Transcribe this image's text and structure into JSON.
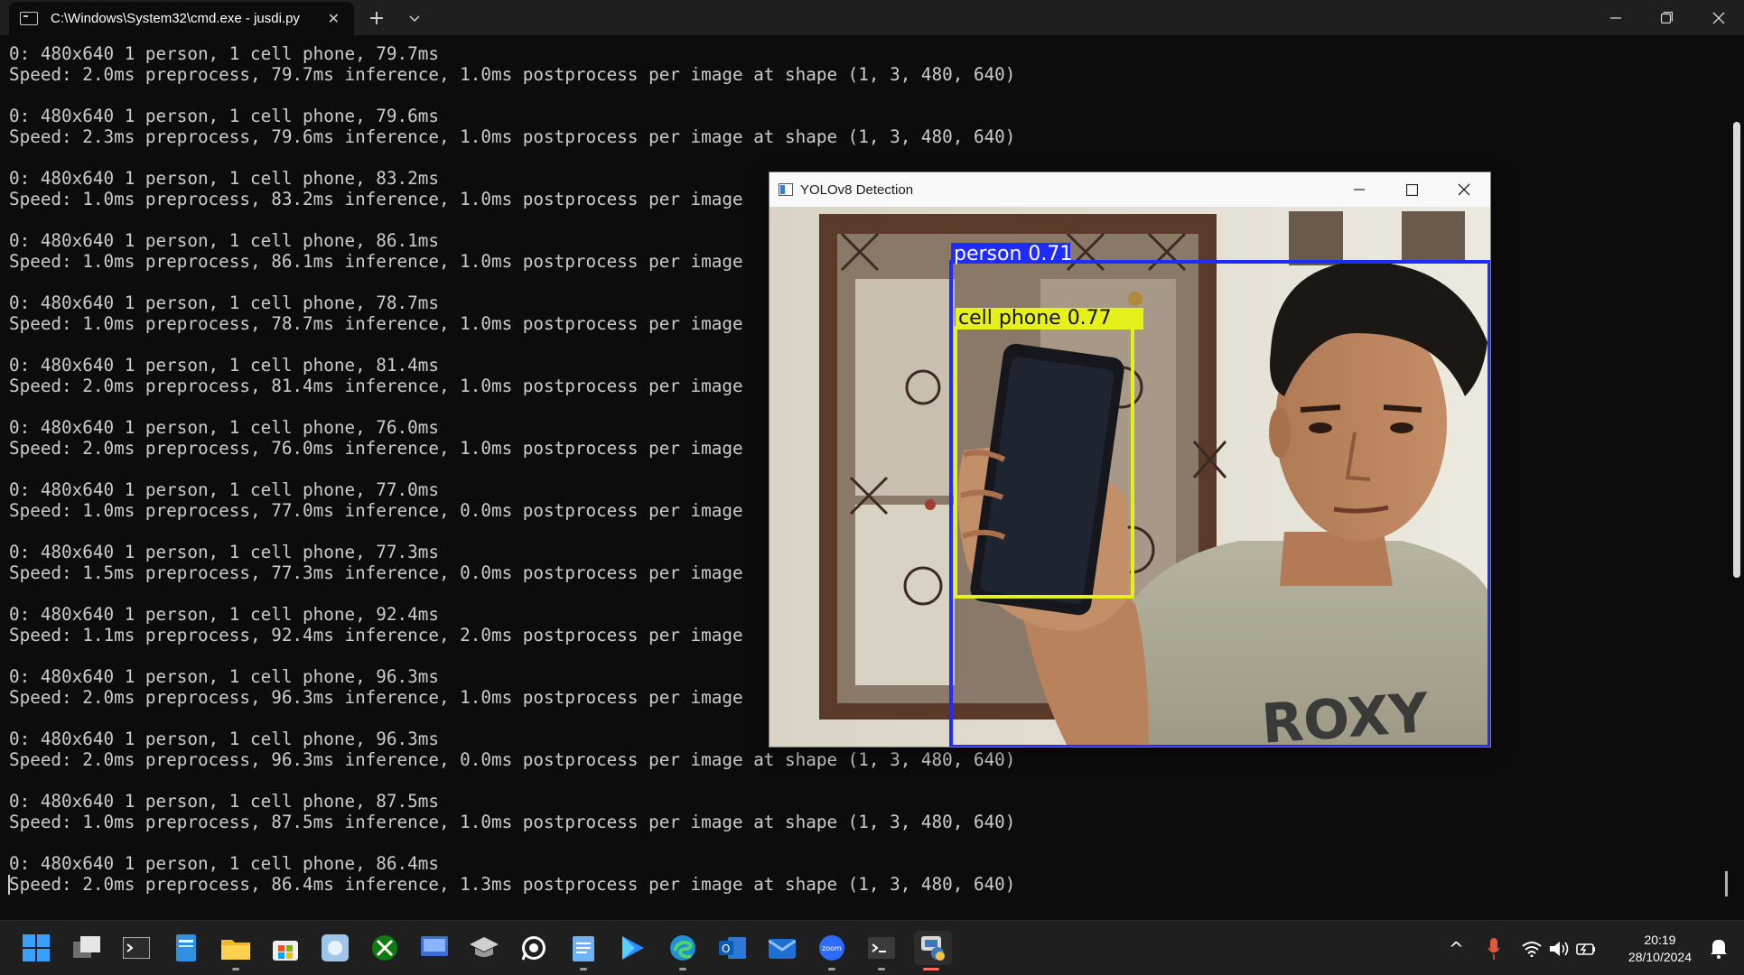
{
  "window": {
    "tab_title": "C:\\Windows\\System32\\cmd.exe - jusdi.py",
    "tab_close": "✕",
    "new_tab": "+",
    "dropdown": "⌄",
    "minimize": "─",
    "restore": "❐",
    "close": "✕"
  },
  "terminal": {
    "lines": [
      "0: 480x640 1 person, 1 cell phone, 79.7ms",
      "Speed: 2.0ms preprocess, 79.7ms inference, 1.0ms postprocess per image at shape (1, 3, 480, 640)",
      "",
      "0: 480x640 1 person, 1 cell phone, 79.6ms",
      "Speed: 2.3ms preprocess, 79.6ms inference, 1.0ms postprocess per image at shape (1, 3, 480, 640)",
      "",
      "0: 480x640 1 person, 1 cell phone, 83.2ms",
      "Speed: 1.0ms preprocess, 83.2ms inference, 1.0ms postprocess per image",
      "",
      "0: 480x640 1 person, 1 cell phone, 86.1ms",
      "Speed: 1.0ms preprocess, 86.1ms inference, 1.0ms postprocess per image",
      "",
      "0: 480x640 1 person, 1 cell phone, 78.7ms",
      "Speed: 1.0ms preprocess, 78.7ms inference, 1.0ms postprocess per image",
      "",
      "0: 480x640 1 person, 1 cell phone, 81.4ms",
      "Speed: 2.0ms preprocess, 81.4ms inference, 1.0ms postprocess per image",
      "",
      "0: 480x640 1 person, 1 cell phone, 76.0ms",
      "Speed: 2.0ms preprocess, 76.0ms inference, 1.0ms postprocess per image",
      "",
      "0: 480x640 1 person, 1 cell phone, 77.0ms",
      "Speed: 1.0ms preprocess, 77.0ms inference, 0.0ms postprocess per image",
      "",
      "0: 480x640 1 person, 1 cell phone, 77.3ms",
      "Speed: 1.5ms preprocess, 77.3ms inference, 0.0ms postprocess per image",
      "",
      "0: 480x640 1 person, 1 cell phone, 92.4ms",
      "Speed: 1.1ms preprocess, 92.4ms inference, 2.0ms postprocess per image",
      "",
      "0: 480x640 1 person, 1 cell phone, 96.3ms",
      "Speed: 2.0ms preprocess, 96.3ms inference, 1.0ms postprocess per image",
      "",
      "0: 480x640 1 person, 1 cell phone, 96.3ms",
      "Speed: 2.0ms preprocess, 96.3ms inference, 0.0ms postprocess per image at shape (1, 3, 480, 640)",
      "",
      "0: 480x640 1 person, 1 cell phone, 87.5ms",
      "Speed: 1.0ms preprocess, 87.5ms inference, 1.0ms postprocess per image at shape (1, 3, 480, 640)",
      "",
      "0: 480x640 1 person, 1 cell phone, 86.4ms",
      "Speed: 2.0ms preprocess, 86.4ms inference, 1.3ms postprocess per image at shape (1, 3, 480, 640)"
    ]
  },
  "detection_window": {
    "title": "YOLOv8 Detection",
    "minimize": "─",
    "maximize": "☐",
    "close": "✕",
    "labels": {
      "person": "person 0.71",
      "phone": "cell phone 0.77"
    },
    "shirt_text": "ROXY",
    "colors": {
      "person_box": "#1f2bff",
      "phone_box": "#e6f01a"
    }
  },
  "taskbar": {
    "icons": [
      "windows-start-icon",
      "task-view-icon",
      "terminal-app-icon",
      "notepad-blue-icon",
      "file-explorer-icon",
      "microsoft-store-icon",
      "photos-icon",
      "xbox-icon",
      "remote-desktop-icon",
      "graduation-cap-icon",
      "whatsapp-icon",
      "notepad-icon",
      "play-store-icon",
      "edge-icon",
      "outlook-icon",
      "outlook-new-icon",
      "zoom-icon",
      "command-prompt-icon",
      "python-icon"
    ],
    "zoom_text": "zoom",
    "chevron": "^",
    "time": "20:19",
    "date": "28/10/2024"
  }
}
